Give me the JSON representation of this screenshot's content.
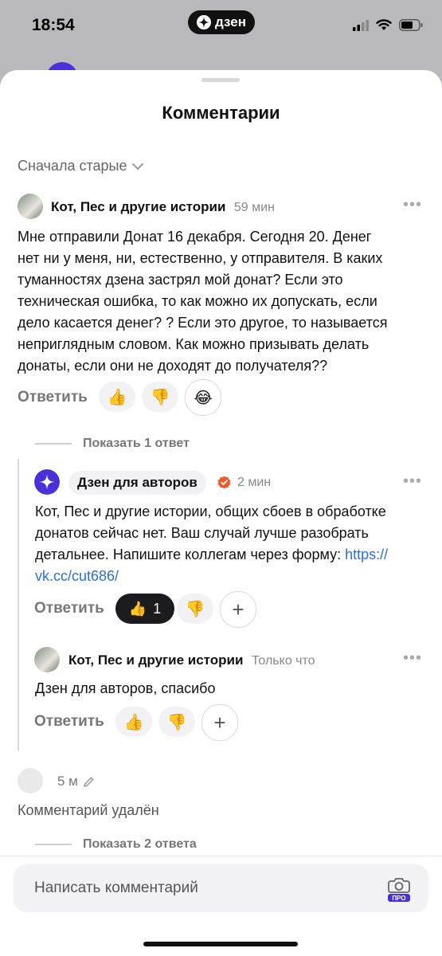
{
  "status_bar": {
    "time": "18:54",
    "brand": "дзен",
    "icons": [
      "signal-icon",
      "wifi-icon",
      "battery-icon"
    ]
  },
  "sheet": {
    "title": "Комментарии",
    "sort_label": "Сначала старые"
  },
  "comment1": {
    "author": "Кот, Пес и другие истории",
    "time": "59 мин",
    "lines": [
      "Мне отправили Донат 16 декабря. Сегодня 20. Денег",
      "нет ни у меня, ни,  естественно, у отправителя. В каких",
      "туманностях дзена застрял мой донат? Если это",
      "техническая ошибка, то как можно их допускать, если",
      "дело касается денег? ? Если это другое, то называется",
      "неприглядным словом. Как можно призывать делать",
      "донаты, если они не доходят до получателя??"
    ],
    "reply_label": "Ответить",
    "show_replies": "Показать 1 ответ"
  },
  "reply1": {
    "author": "Дзен для авторов",
    "time": "2 мин",
    "lines": [
      "Кот, Пес и другие истории, общих сбоев в обработке",
      "донатов сейчас нет. Ваш случай лучше разобрать",
      "детальнее. Напишите коллегам через форму: "
    ],
    "link_part1": "https://",
    "link_part2": "vk.cc/cut686/",
    "reply_label": "Ответить",
    "like_count": "1"
  },
  "reply2": {
    "author": "Кот, Пес и другие истории",
    "time": "Только что",
    "text": "Дзен для авторов, спасибо",
    "reply_label": "Ответить"
  },
  "comment2": {
    "time": "5 м",
    "text": "Комментарий удалён",
    "show_replies": "Показать 2 ответа"
  },
  "composer": {
    "placeholder": "Написать комментарий",
    "badge": "ПРО"
  },
  "colors": {
    "accent": "#4b2fd8",
    "link": "#2b6fd6",
    "verified": "#f05a28"
  }
}
